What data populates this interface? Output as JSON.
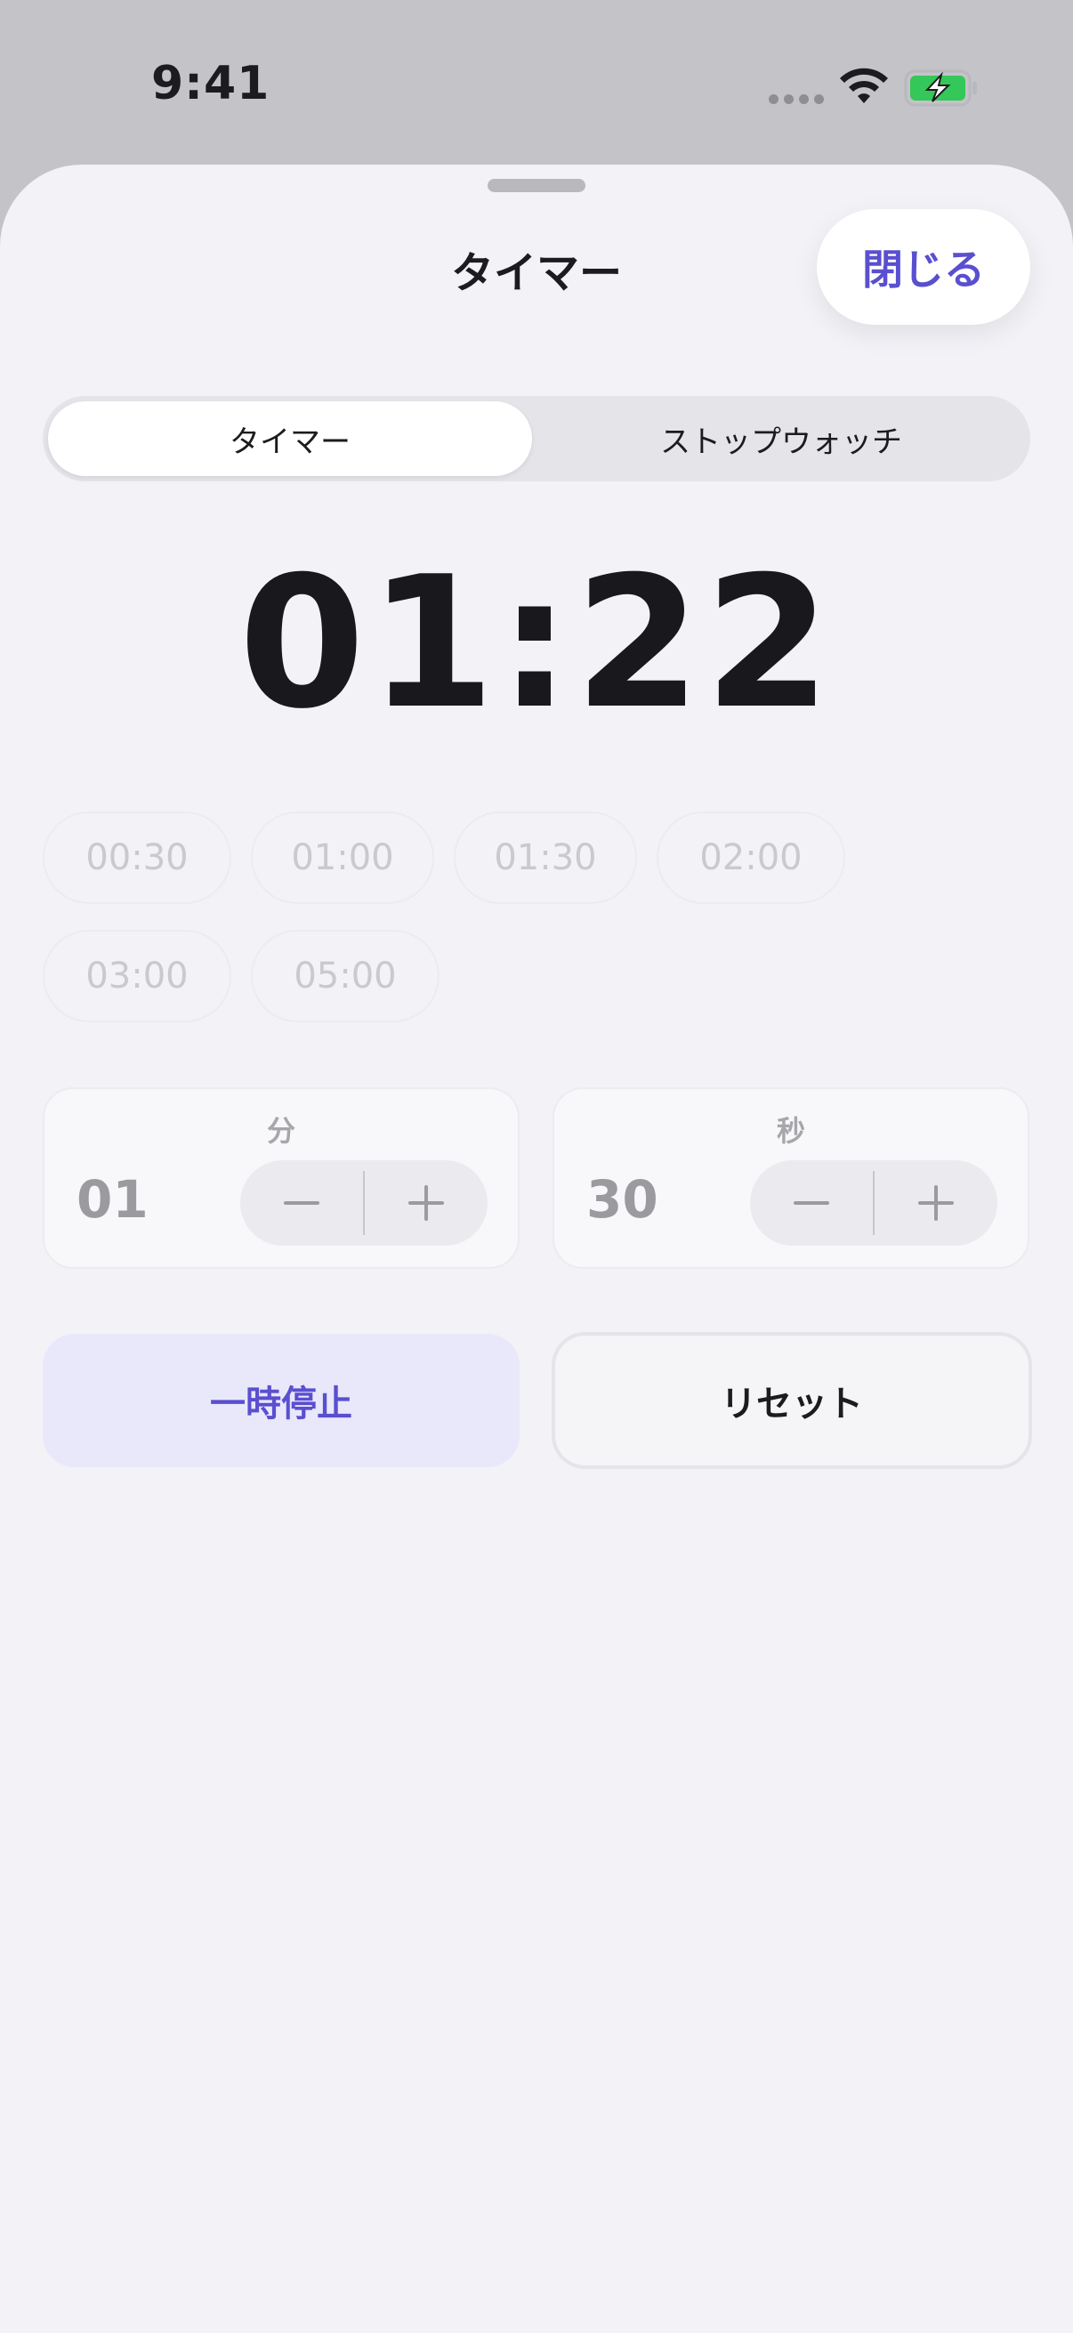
{
  "status_bar": {
    "time": "9:41",
    "icons": [
      "cellular-dots-icon",
      "wifi-icon",
      "battery-charging-icon"
    ],
    "battery_color": "#34c759"
  },
  "sheet": {
    "title": "タイマー",
    "close_label": "閉じる",
    "accent_color": "#5a4fcf"
  },
  "segment": {
    "tabs": [
      {
        "label": "タイマー",
        "selected": true
      },
      {
        "label": "ストップウォッチ",
        "selected": false
      }
    ]
  },
  "timer": {
    "display": "01:22"
  },
  "presets": [
    "00:30",
    "01:00",
    "01:30",
    "02:00",
    "03:00",
    "05:00"
  ],
  "steppers": {
    "minutes": {
      "label": "分",
      "value": "01"
    },
    "seconds": {
      "label": "秒",
      "value": "30"
    }
  },
  "actions": {
    "pause_label": "一時停止",
    "reset_label": "リセット"
  }
}
